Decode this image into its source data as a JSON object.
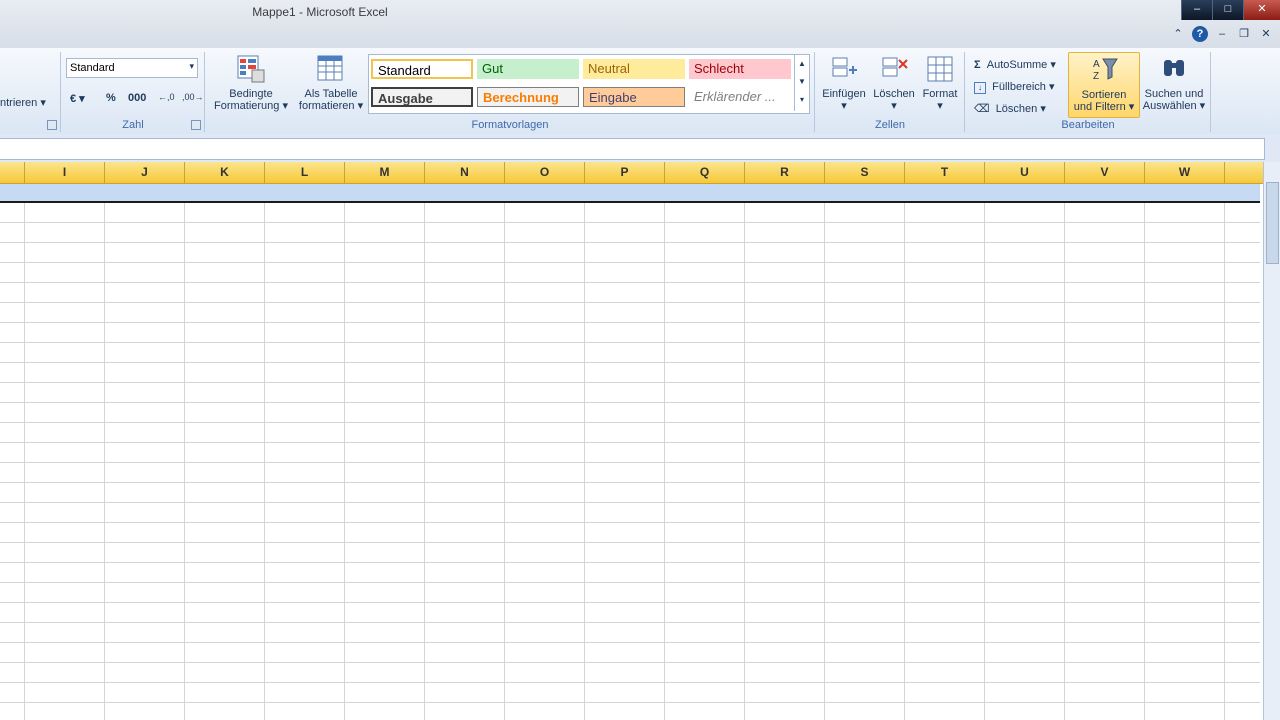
{
  "window": {
    "title": "Mappe1  -  Microsoft Excel",
    "controls": [
      "–",
      "□",
      "✕"
    ]
  },
  "ribbon": {
    "alignment_fragment": "ntrieren",
    "number": {
      "format_value": "Standard",
      "currency_symbol": "€",
      "percent_symbol": "%",
      "thousands_symbol": "000",
      "increase_decimal": "←,0",
      "decrease_decimal": ",00→",
      "group_label": "Zahl"
    },
    "conditional_formatting": {
      "line1": "Bedingte",
      "line2": "Formatierung"
    },
    "format_as_table": {
      "line1": "Als Tabelle",
      "line2": "formatieren"
    },
    "styles": {
      "group_label": "Formatvorlagen",
      "cells": [
        "Standard",
        "Gut",
        "Neutral",
        "Schlecht",
        "Ausgabe",
        "Berechnung",
        "Eingabe",
        "Erklärender ..."
      ]
    },
    "cells": {
      "group_label": "Zellen",
      "insert": "Einfügen",
      "delete": "Löschen",
      "format": "Format"
    },
    "editing": {
      "group_label": "Bearbeiten",
      "autosum": "AutoSumme",
      "fill": "Füllbereich",
      "clear": "Löschen",
      "sort_filter": {
        "line1": "Sortieren",
        "line2": "und Filtern"
      },
      "find_select": {
        "line1": "Suchen und",
        "line2": "Auswählen"
      }
    }
  },
  "sheet": {
    "columns": [
      "I",
      "J",
      "K",
      "L",
      "M",
      "N",
      "O",
      "P",
      "Q",
      "R",
      "S",
      "T",
      "U",
      "V",
      "W"
    ]
  },
  "colors": {
    "header_yellow": "#f7c839",
    "selection_blue": "#c7daf4",
    "style_gut": "#c6efce",
    "style_neutral": "#ffeb9c",
    "style_schlecht": "#ffc7ce",
    "style_eingabe": "#ffcc99"
  }
}
